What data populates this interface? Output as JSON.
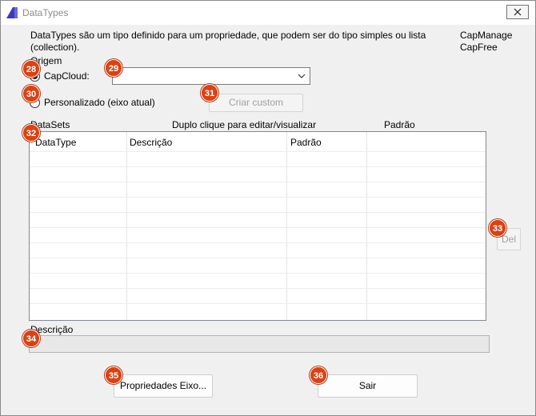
{
  "window": {
    "title": "DataTypes",
    "close_symbol": "×"
  },
  "description": "DataTypes são um tipo definido para um propriedade, que podem ser do tipo simples ou lista (collection).",
  "modes": [
    "CapManage",
    "CapFree"
  ],
  "origin": {
    "label": "Origem",
    "capcloud_label": "CapCloud:",
    "capcloud_selected": true,
    "capcloud_value": "",
    "custom_label": "Personalizado (eixo atual)",
    "custom_selected": false,
    "create_custom_button": "Criar custom"
  },
  "grid_section": {
    "datasets_label": "DataSets",
    "hint": "Duplo clique para editar/visualizar",
    "default_label": "Padrão",
    "columns": [
      "DataType",
      "Descrição",
      "Padrão",
      ""
    ],
    "rows": []
  },
  "del_button": "Del",
  "description_section": {
    "label": "Descrição",
    "value": ""
  },
  "footer": {
    "properties_button": "Propriedades Eixo...",
    "exit_button": "Sair"
  },
  "badges": [
    "28",
    "29",
    "30",
    "31",
    "32",
    "33",
    "34",
    "35",
    "36"
  ],
  "colors": {
    "badge": "#d84315",
    "window_bg": "#f0f0f0",
    "title_text": "#8c8c8c"
  },
  "icons": {
    "app": "datatypes-app-icon",
    "close": "close-icon",
    "dropdown": "chevron-down-icon"
  }
}
